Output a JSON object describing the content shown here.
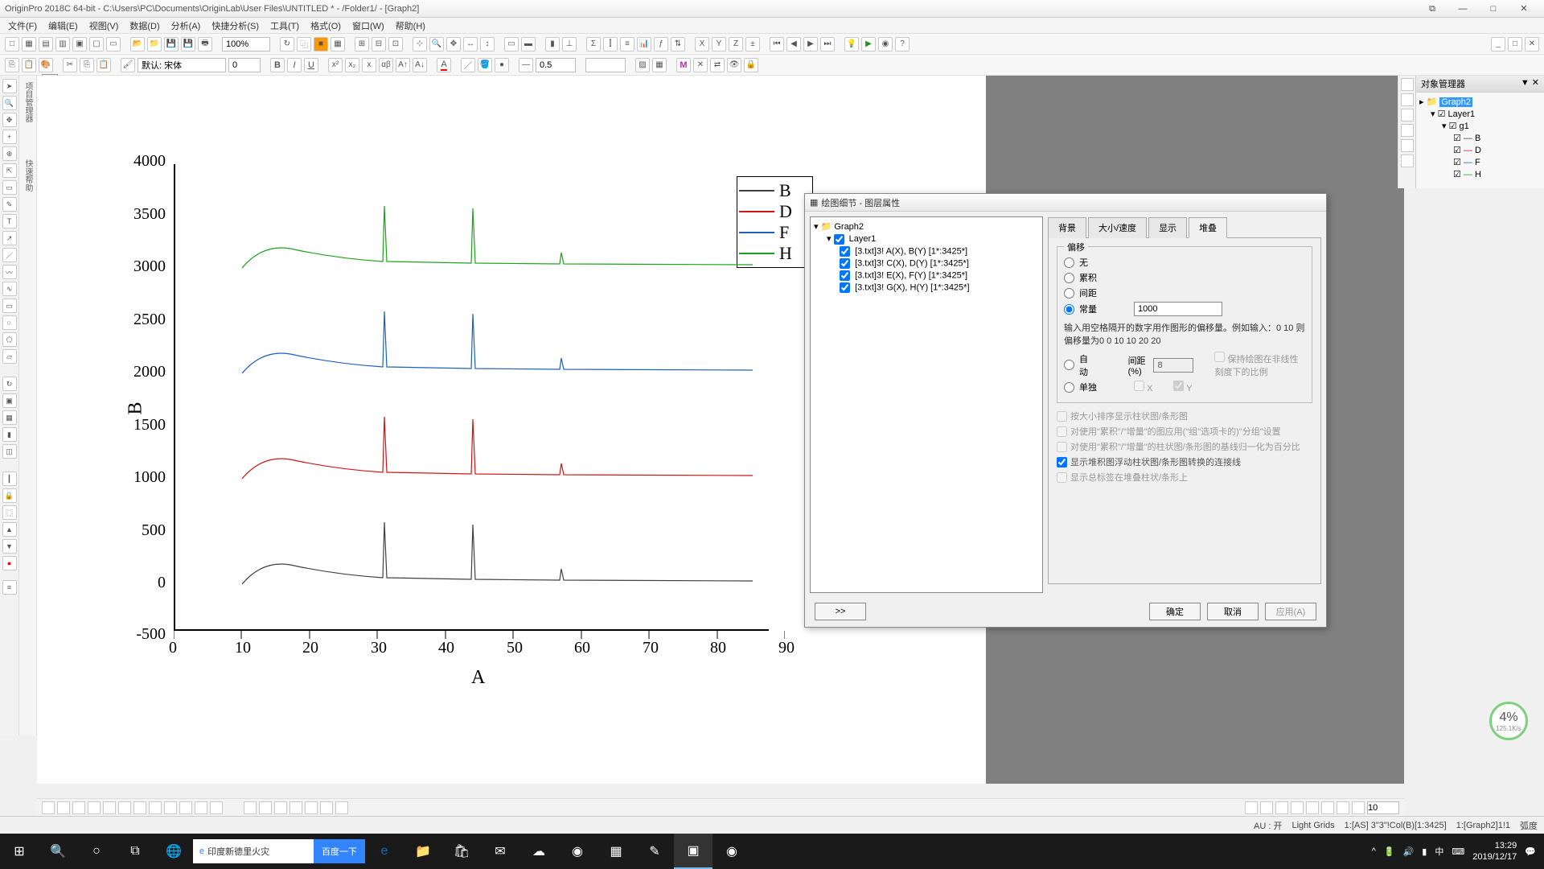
{
  "app": {
    "title": "OriginPro 2018C 64-bit - C:\\Users\\PC\\Documents\\OriginLab\\User Files\\UNTITLED * - /Folder1/ - [Graph2]"
  },
  "menu": [
    "文件(F)",
    "编辑(E)",
    "视图(V)",
    "数据(D)",
    "分析(A)",
    "快捷分析(S)",
    "工具(T)",
    "格式(O)",
    "窗口(W)",
    "帮助(H)"
  ],
  "toolbar1": {
    "zoom": "100%"
  },
  "toolbar2": {
    "font": "默认: 宋体",
    "size": "0",
    "linewidth": "0.5"
  },
  "chart_data": {
    "type": "line",
    "xlabel": "A",
    "ylabel": "B",
    "xlim": [
      0,
      90
    ],
    "ylim": [
      -500,
      4000
    ],
    "xticks": [
      0,
      10,
      20,
      30,
      40,
      50,
      60,
      70,
      80,
      90
    ],
    "yticks": [
      -500,
      0,
      500,
      1000,
      1500,
      2000,
      2500,
      3000,
      3500,
      4000
    ],
    "series": [
      {
        "name": "B",
        "color": "#404040",
        "offset": 0,
        "baseline": 80,
        "note": "baseline ≈80, peaks at x≈32 (h≈530) and x≈45 (h≈500)"
      },
      {
        "name": "D",
        "color": "#d01515",
        "offset": 1000,
        "baseline": 80,
        "note": "baseline ≈1080, peaks at x≈32 and x≈45"
      },
      {
        "name": "F",
        "color": "#1f5fb8",
        "offset": 2000,
        "baseline": 80,
        "note": "baseline ≈2080, peaks at x≈32 and x≈45"
      },
      {
        "name": "H",
        "color": "#1fa01f",
        "offset": 3000,
        "baseline": 80,
        "note": "baseline ≈3080, peaks at x≈32 and x≈45"
      }
    ],
    "legend": [
      "B",
      "D",
      "F",
      "H"
    ]
  },
  "dialog": {
    "title": "绘图细节 - 图层属性",
    "tree": {
      "root": "Graph2",
      "layer": "Layer1",
      "plots": [
        "[3.txt]3! A(X), B(Y) [1*:3425*]",
        "[3.txt]3! C(X), D(Y) [1*:3425*]",
        "[3.txt]3! E(X), F(Y) [1*:3425*]",
        "[3.txt]3! G(X), H(Y) [1*:3425*]"
      ]
    },
    "tabs": [
      "背景",
      "大小/速度",
      "显示",
      "堆叠"
    ],
    "active_tab": "堆叠",
    "group_label": "偏移",
    "radios": {
      "none": "无",
      "cumulative": "累积",
      "gap": "间距",
      "constant": "常量",
      "auto": "自动",
      "individual": "单独"
    },
    "constant_value": "1000",
    "hint": "输入用空格隔开的数字用作图形的偏移量。例如输入：0 10 则偏移量为0 0 10 10 20 20",
    "gap_label": "间距(%)",
    "gap_value": "8",
    "checkbox_keep": "保持绘图在非线性刻度下的比例",
    "checkbox_x": "X",
    "checkbox_y": "Y",
    "checks": [
      "按大小排序显示柱状图/条形图",
      "对使用\"累积\"/\"增量\"的图应用(\"组\"选项卡的)\"分组\"设置",
      "对使用\"累积\"/\"增量\"的柱状图/条形图的基线归一化为百分比",
      "显示堆积图浮动柱状图/条形图转换的连接线",
      "显示总标签在堆叠柱状/条形上"
    ],
    "checks_checked": [
      false,
      false,
      false,
      true,
      false
    ],
    "buttons": {
      "expand": ">>",
      "ok": "确定",
      "cancel": "取消",
      "apply": "应用(A)"
    }
  },
  "rightpanel": {
    "title": "对象管理器",
    "root": "Graph2",
    "layer": "Layer1",
    "group": "g1",
    "items": [
      "B",
      "D",
      "F",
      "H"
    ]
  },
  "status": {
    "au": "AU : 开",
    "grids": "Light Grids",
    "sel": "1:[AS] 3\"3\"!Col(B)[1:3425]",
    "win": "1:[Graph2]1!1",
    "enc": "弧度"
  },
  "taskbar": {
    "searchtext": "印度新德里火灾",
    "searchbtn": "百度一下",
    "clock_time": "13:29",
    "clock_date": "2019/12/17"
  },
  "perf": {
    "pct": "4%",
    "spd": "125.1K/s"
  }
}
